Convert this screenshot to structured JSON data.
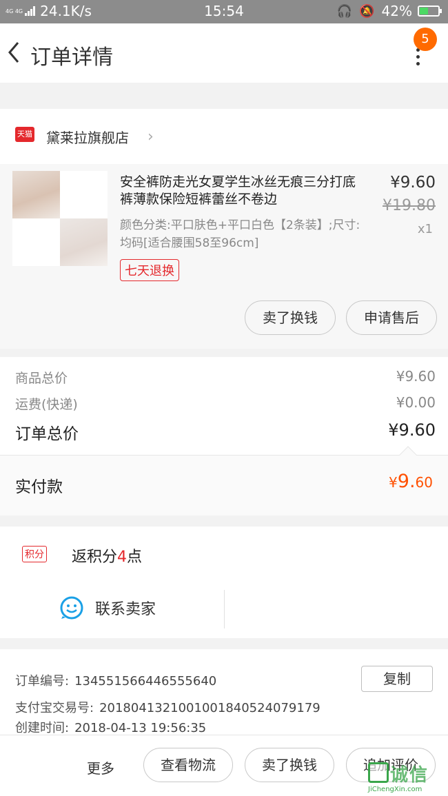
{
  "status_bar": {
    "network": "4G 4G",
    "speed": "24.1K/s",
    "time": "15:54",
    "battery": "42%",
    "battery_level": 0.42,
    "colors": {
      "bar": "#8c8c8c",
      "battery_fill": "#4cd964"
    }
  },
  "nav": {
    "title": "订单详情",
    "badge": "5",
    "icons": {
      "back": "chevron-left-icon",
      "more": "more-vertical-icon"
    }
  },
  "shop": {
    "logo_text": "天猫",
    "name": "黛莱拉旗舰店",
    "chevron": "›"
  },
  "product": {
    "title": "安全裤防走光女夏学生冰丝无痕三分打底裤薄款保险短裤蕾丝不卷边",
    "sku": "颜色分类:平口肤色+平口白色【2条装】;尺寸:均码[适合腰围58至96cm]",
    "tag": "七天退换",
    "price": "¥9.60",
    "original_price": "¥19.80",
    "quantity": "x1",
    "buttons": {
      "sell": "卖了换钱",
      "after_sale": "申请售后"
    }
  },
  "summary": {
    "goods_total_label": "商品总价",
    "goods_total_value": "¥9.60",
    "shipping_label": "运费(快递)",
    "shipping_value": "¥0.00",
    "order_total_label": "订单总价",
    "order_total_value": "¥9.60",
    "paid_label": "实付款",
    "paid_symbol": "¥",
    "paid_int": "9.",
    "paid_dec": "60"
  },
  "points": {
    "tag": "积分",
    "text_prefix": "返积分",
    "number": "4",
    "text_suffix": "点",
    "contact_label": "联系卖家",
    "contact_icon": "chat-smile-icon"
  },
  "info": {
    "order_no_label": "订单编号:",
    "order_no": "134551566446555640",
    "alipay_label": "支付宝交易号:",
    "alipay_no": "2018041321001001840524079179",
    "created_label": "创建时间:",
    "created_time": "2018-04-13 19:56:35",
    "copy_label": "复制"
  },
  "bottom_bar": {
    "more": "更多",
    "logistics": "查看物流",
    "sell": "卖了换钱",
    "review": "追加评价"
  },
  "watermark": {
    "cn": "诚信",
    "en": "JiChengXin.com"
  },
  "colors": {
    "accent_orange": "#ff5000",
    "tmall_red": "#e4282c",
    "badge_orange": "#ff6a00"
  }
}
